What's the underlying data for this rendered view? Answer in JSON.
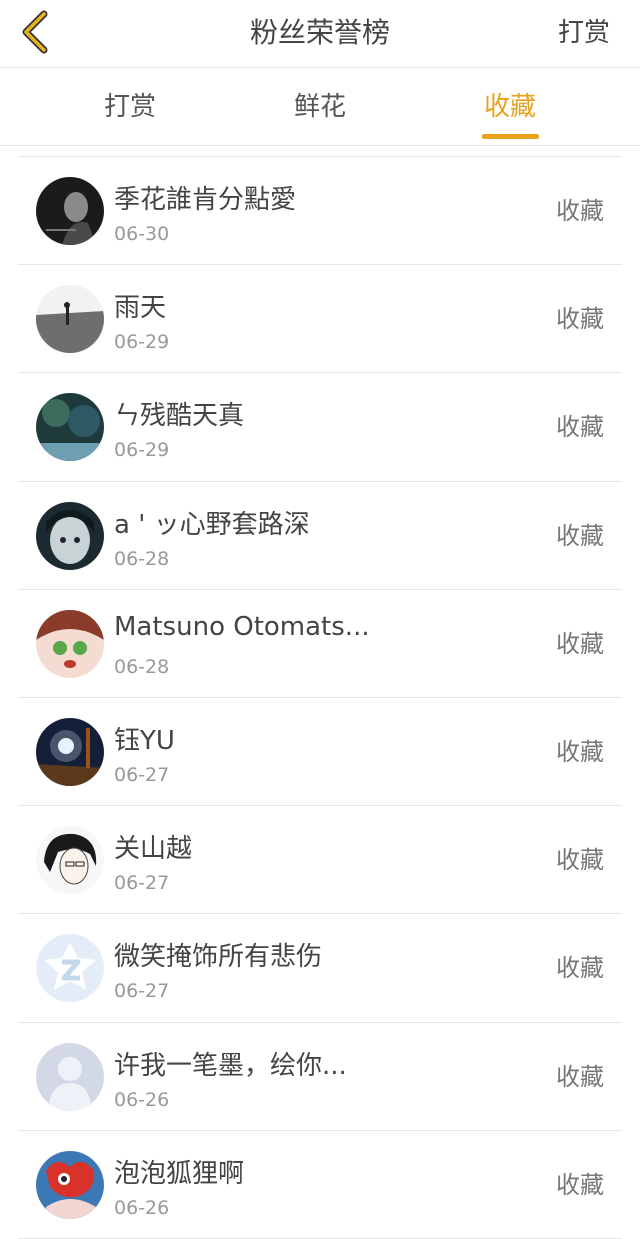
{
  "header": {
    "title": "粉丝荣誉榜",
    "action_label": "打赏",
    "accent_color": "#e8a21d"
  },
  "tabs": [
    {
      "label": "打赏",
      "active": false
    },
    {
      "label": "鲜花",
      "active": false
    },
    {
      "label": "收藏",
      "active": true
    }
  ],
  "list": {
    "items": [
      {
        "name": "季花誰肯分點愛",
        "date": "06-30",
        "action": "收藏"
      },
      {
        "name": "雨天",
        "date": "06-29",
        "action": "收藏"
      },
      {
        "name": "ㄣ残酷天真",
        "date": "06-29",
        "action": "收藏"
      },
      {
        "name": "a ' ッ心野套路深",
        "date": "06-28",
        "action": "收藏"
      },
      {
        "name": "Matsuno Otomats...",
        "date": "06-28",
        "action": "收藏"
      },
      {
        "name": "钰YU",
        "date": "06-27",
        "action": "收藏"
      },
      {
        "name": "关山越",
        "date": "06-27",
        "action": "收藏"
      },
      {
        "name": "微笑掩饰所有悲伤",
        "date": "06-27",
        "action": "收藏"
      },
      {
        "name": "许我一笔墨，绘你...",
        "date": "06-26",
        "action": "收藏"
      },
      {
        "name": "泡泡狐狸啊",
        "date": "06-26",
        "action": "收藏"
      }
    ]
  }
}
